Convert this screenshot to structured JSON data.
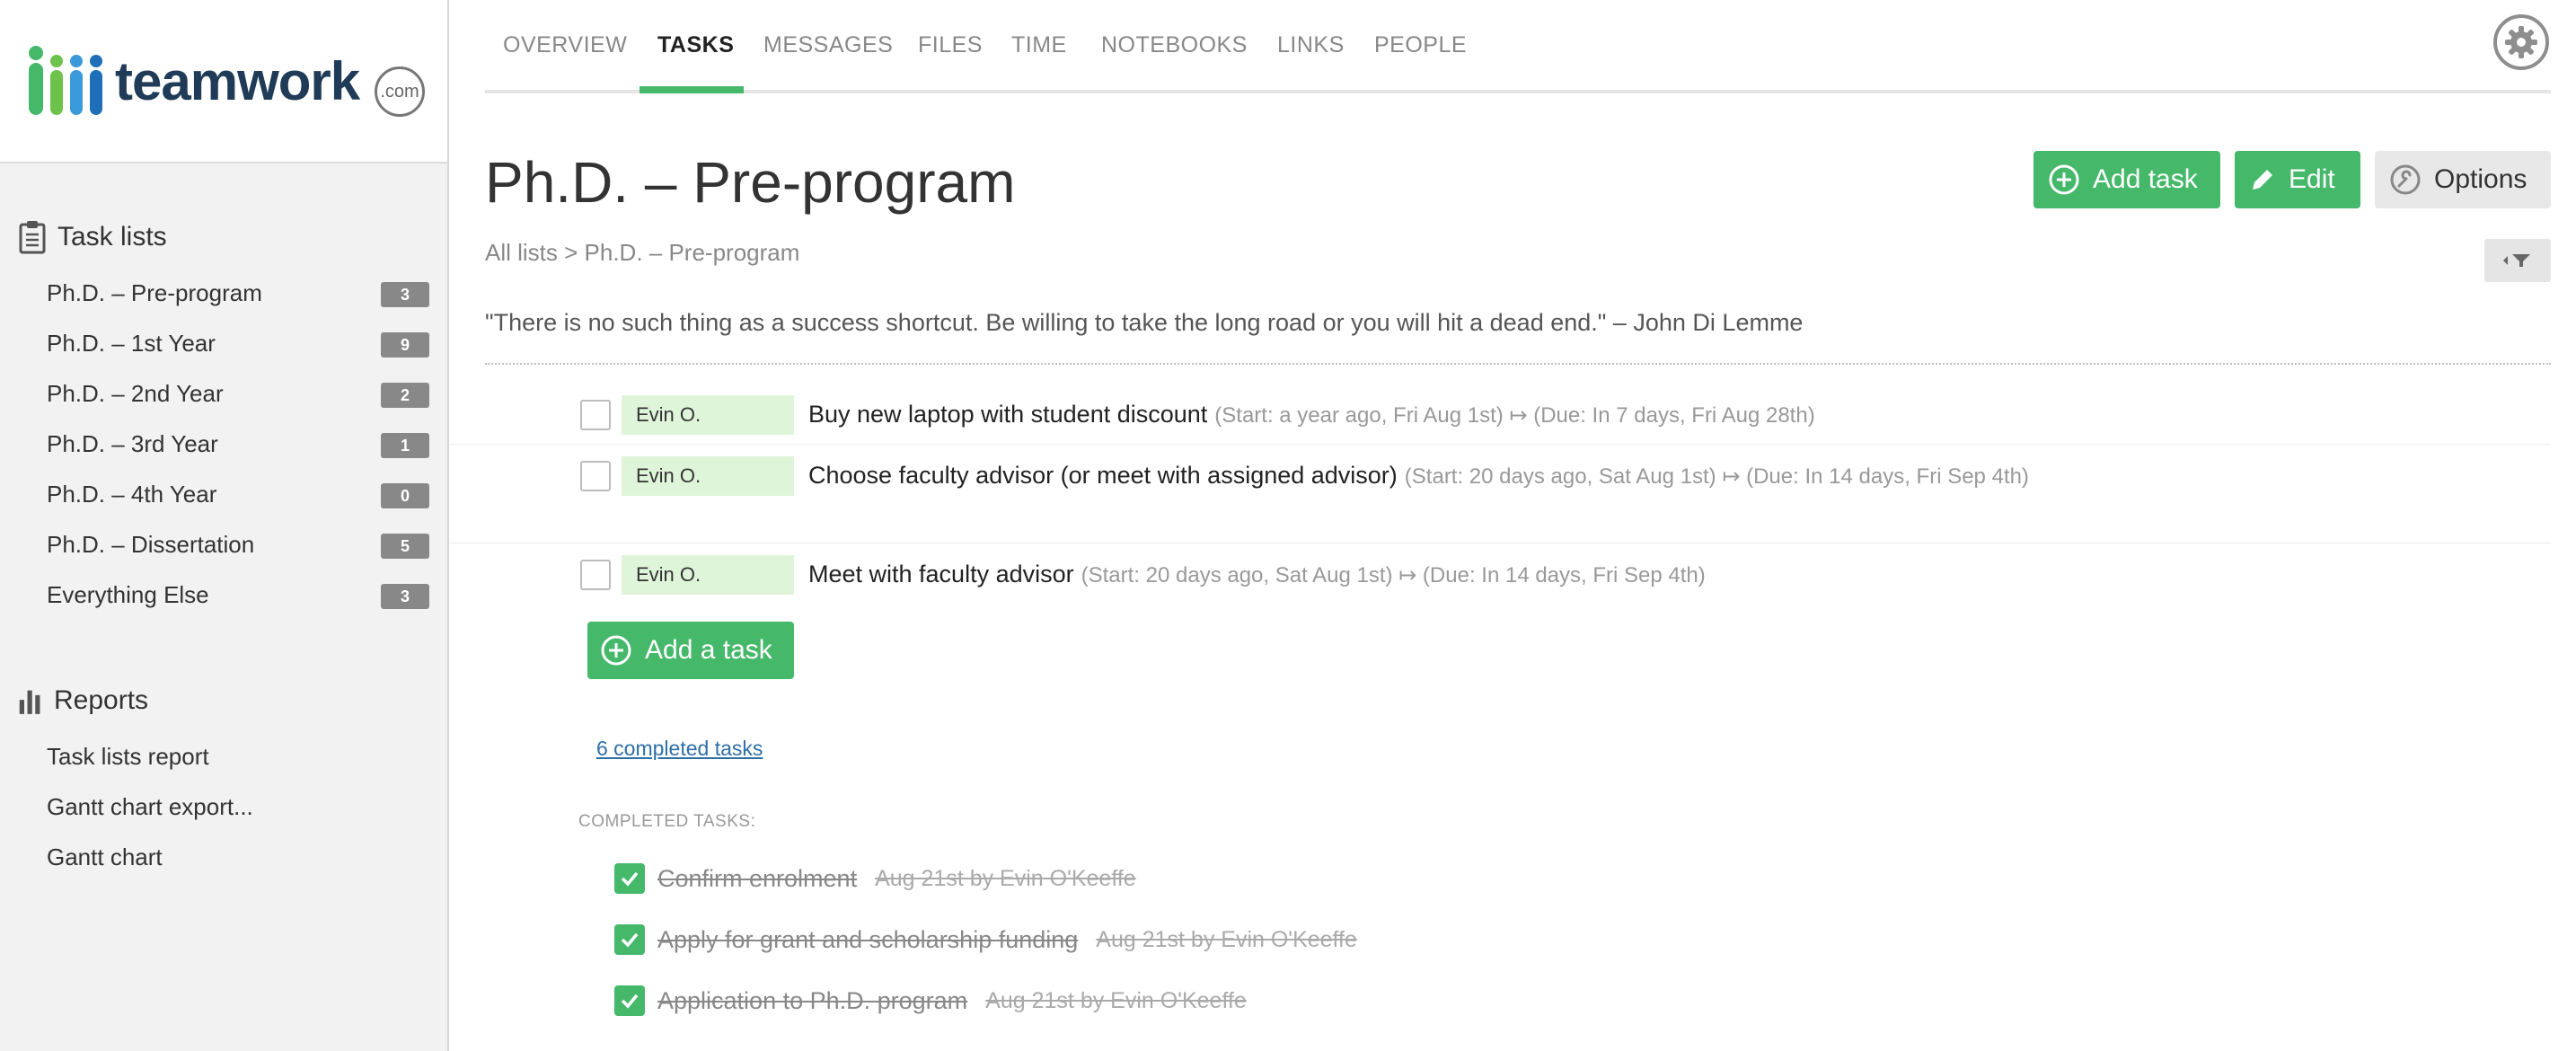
{
  "logo": {
    "text": "teamwork",
    "suffix": ".com"
  },
  "nav": {
    "tabs": [
      "OVERVIEW",
      "TASKS",
      "MESSAGES",
      "FILES",
      "TIME",
      "NOTEBOOKS",
      "LINKS",
      "PEOPLE"
    ],
    "active": "TASKS"
  },
  "sidebar": {
    "task_lists_heading": "Task lists",
    "task_lists": [
      {
        "label": "Ph.D. – Pre-program",
        "count": "3"
      },
      {
        "label": "Ph.D. – 1st Year",
        "count": "9"
      },
      {
        "label": "Ph.D. – 2nd Year",
        "count": "2"
      },
      {
        "label": "Ph.D. – 3rd Year",
        "count": "1"
      },
      {
        "label": "Ph.D. – 4th Year",
        "count": "0"
      },
      {
        "label": "Ph.D. – Dissertation",
        "count": "5"
      },
      {
        "label": "Everything Else",
        "count": "3"
      }
    ],
    "reports_heading": "Reports",
    "reports": [
      "Task lists report",
      "Gantt chart export...",
      "Gantt chart"
    ]
  },
  "header": {
    "title": "Ph.D. – Pre-program",
    "breadcrumb": "All lists > Ph.D. – Pre-program",
    "add_task_label": "Add task",
    "edit_label": "Edit",
    "options_label": "Options"
  },
  "quote": "\"There is no such thing as a success shortcut. Be willing to take the long road or you will hit a dead end.\" – John Di Lemme",
  "tasks": [
    {
      "assignee": "Evin O.",
      "name": "Buy new laptop with student discount",
      "meta": "(Start: a year ago, Fri Aug 1st) ↦ (Due: In 7 days, Fri Aug 28th)"
    },
    {
      "assignee": "Evin O.",
      "name": "Choose faculty advisor (or meet with assigned advisor)",
      "meta": "(Start: 20 days ago, Sat Aug 1st) ↦ (Due: In 14 days, Fri Sep 4th)"
    },
    {
      "assignee": "Evin O.",
      "name": "Meet with faculty advisor",
      "meta": "(Start: 20 days ago, Sat Aug 1st) ↦ (Due: In 14 days, Fri Sep 4th)"
    }
  ],
  "add_a_task_label": "Add a task",
  "completed_link": "6 completed tasks",
  "completed_heading": "COMPLETED TASKS:",
  "completed_tasks": [
    {
      "name": "Confirm enrolment",
      "meta": "Aug 21st by Evin O'Keeffe"
    },
    {
      "name": "Apply for grant and scholarship funding",
      "meta": "Aug 21st by Evin O'Keeffe"
    },
    {
      "name": "Application to Ph.D. program",
      "meta": "Aug 21st by Evin O'Keeffe"
    }
  ],
  "colors": {
    "accent": "#45b86a",
    "badge": "#888888",
    "assignee_bg": "#dff5da"
  }
}
